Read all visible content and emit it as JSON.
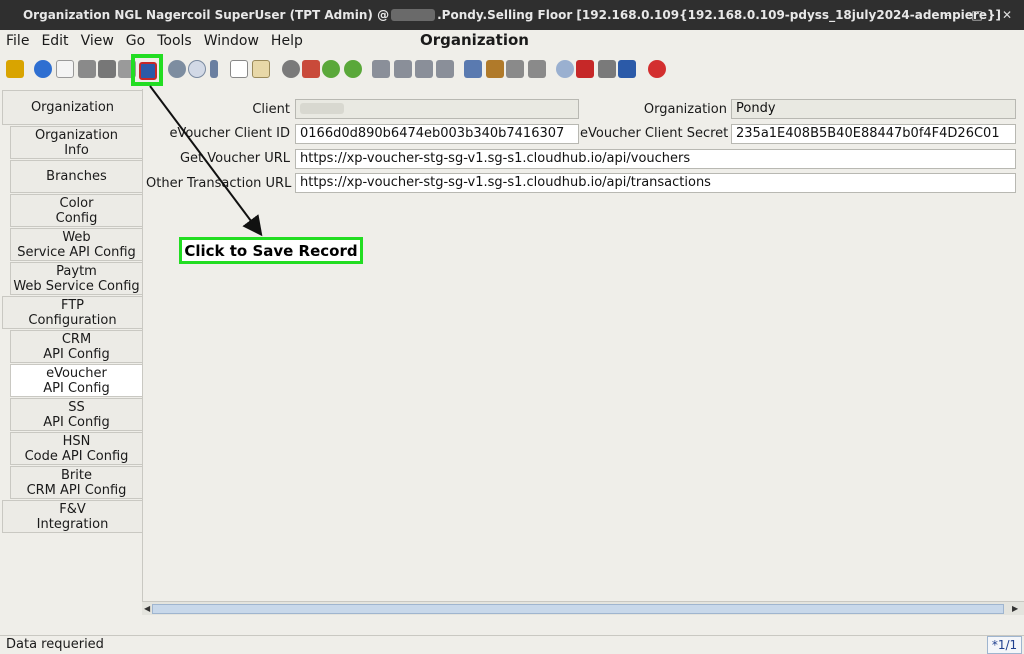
{
  "window": {
    "title_prefix": "Organization  NGL  Nagercoil  SuperUser (TPT Admin) @",
    "title_suffix": ".Pondy.Selling Floor [192.168.0.109{192.168.0.109-pdyss_18july2024-adempiere}]",
    "min": "–",
    "max": "□",
    "close": "✕"
  },
  "menu": {
    "items": [
      "File",
      "Edit",
      "View",
      "Go",
      "Tools",
      "Window",
      "Help"
    ],
    "title": "Organization"
  },
  "tabs": [
    "Organization",
    "Organization\nInfo",
    "Branches",
    "Color\nConfig",
    "Web\nService API Config",
    "Paytm\nWeb Service Config",
    "FTP\nConfiguration",
    "CRM\nAPI Config",
    "eVoucher\nAPI Config",
    "SS\nAPI Config",
    "HSN\nCode API Config",
    "Brite\nCRM API Config",
    "F&V\nIntegration"
  ],
  "form": {
    "client_label": "Client",
    "org_label": "Organization",
    "org_value": "Pondy",
    "evoucher_id_label": "eVoucher Client ID",
    "evoucher_id_value": "0166d0d890b6474eb003b340b7416307",
    "evoucher_secret_label": "eVoucher Client Secret",
    "evoucher_secret_value": "235a1E408B5B40E88447b0f4F4D26C01",
    "get_voucher_label": "Get Voucher URL",
    "get_voucher_value": "https://xp-voucher-stg-sg-v1.sg-s1.cloudhub.io/api/vouchers",
    "other_txn_label": "Other Transaction URL",
    "other_txn_value": "https://xp-voucher-stg-sg-v1.sg-s1.cloudhub.io/api/transactions"
  },
  "callout": {
    "text": "Click to Save Record"
  },
  "status": {
    "message": "Data requeried",
    "count": "*1/1"
  },
  "colors": {
    "highlight": "#22dd22",
    "title_bg": "#2f2f2f"
  }
}
